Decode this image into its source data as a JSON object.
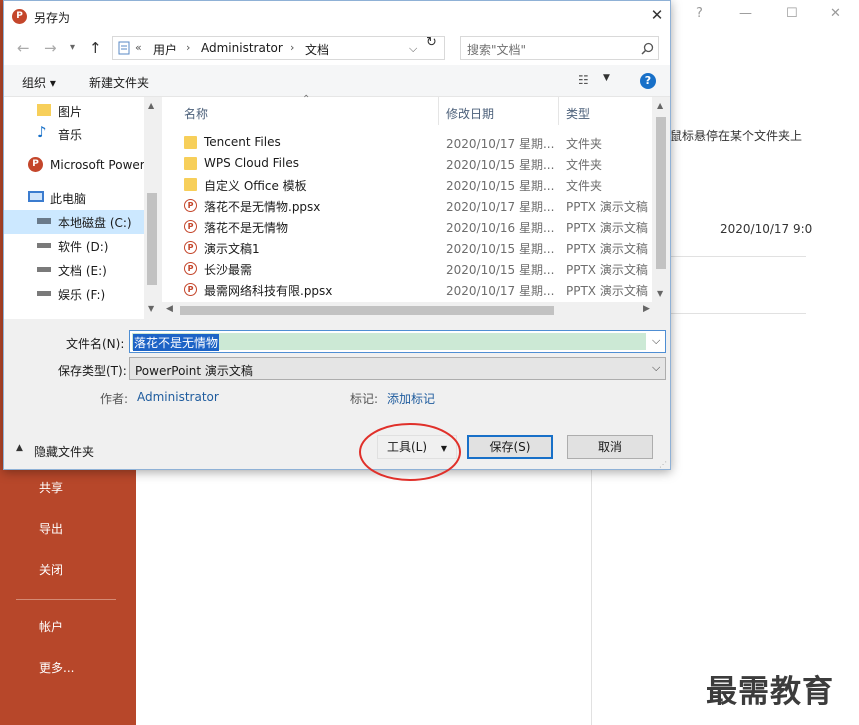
{
  "background": {
    "nav_items": [
      "共享",
      "导出",
      "关闭",
      "帐户",
      "更多..."
    ],
    "hint_text": "鼠标悬停在某个文件夹上",
    "date_text": "2020/10/17 9:0",
    "watermark": "最需教育"
  },
  "dialog": {
    "title": "另存为",
    "address": {
      "crumbs": [
        "用户",
        "Administrator",
        "文档"
      ],
      "search_placeholder": "搜索\"文档\""
    },
    "toolbar": {
      "organize": "组织 ▾",
      "new_folder": "新建文件夹"
    },
    "nav_pane": [
      {
        "label": "图片",
        "icon": "pictures-folder-icon"
      },
      {
        "label": "音乐",
        "icon": "music-icon"
      },
      {
        "label": "Microsoft Power",
        "icon": "powerpoint-icon"
      },
      {
        "label": "此电脑",
        "icon": "computer-icon"
      },
      {
        "label": "本地磁盘 (C:)",
        "icon": "drive-icon"
      },
      {
        "label": "软件 (D:)",
        "icon": "drive-icon"
      },
      {
        "label": "文档 (E:)",
        "icon": "drive-icon"
      },
      {
        "label": "娱乐 (F:)",
        "icon": "drive-icon"
      }
    ],
    "columns": {
      "name": "名称",
      "date": "修改日期",
      "type": "类型"
    },
    "files": [
      {
        "name": "Tencent Files",
        "date": "2020/10/17 星期...",
        "type": "文件夹",
        "kind": "folder"
      },
      {
        "name": "WPS Cloud Files",
        "date": "2020/10/15 星期...",
        "type": "文件夹",
        "kind": "folder"
      },
      {
        "name": "自定义 Office 模板",
        "date": "2020/10/15 星期...",
        "type": "文件夹",
        "kind": "folder"
      },
      {
        "name": "落花不是无情物.ppsx",
        "date": "2020/10/17 星期...",
        "type": "PPTX 演示文稿",
        "kind": "pptx"
      },
      {
        "name": "落花不是无情物",
        "date": "2020/10/16 星期...",
        "type": "PPTX 演示文稿",
        "kind": "pptx"
      },
      {
        "name": "演示文稿1",
        "date": "2020/10/15 星期...",
        "type": "PPTX 演示文稿",
        "kind": "pptx"
      },
      {
        "name": "长沙最需",
        "date": "2020/10/15 星期...",
        "type": "PPTX 演示文稿",
        "kind": "pptx"
      },
      {
        "name": "最需网络科技有限.ppsx",
        "date": "2020/10/17 星期...",
        "type": "PPTX 演示文稿",
        "kind": "pptx"
      }
    ],
    "filename_label": "文件名(N):",
    "filename_value": "落花不是无情物",
    "filetype_label": "保存类型(T):",
    "filetype_value": "PowerPoint 演示文稿",
    "author_label": "作者:",
    "author_value": "Administrator",
    "tags_label": "标记:",
    "tags_value": "添加标记",
    "hide_folders": "隐藏文件夹",
    "tools_button": "工具(L)",
    "save_button": "保存(S)",
    "cancel_button": "取消"
  },
  "colors": {
    "sidebar": "#b7472a",
    "accent": "#1870c8",
    "annotation_circle": "#e0302a"
  }
}
